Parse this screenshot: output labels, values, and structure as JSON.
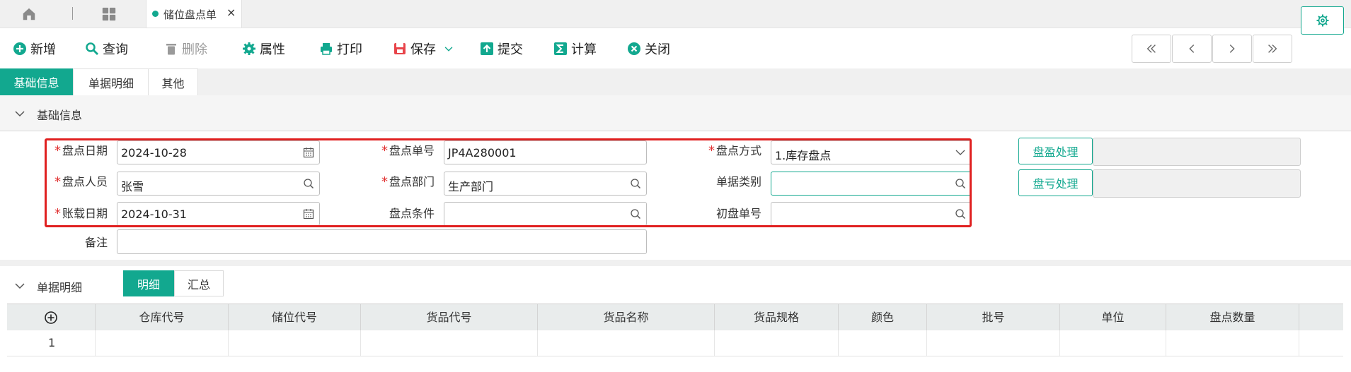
{
  "tabbar": {
    "doc_tab_label": "储位盘点单",
    "doc_tab_close": "×"
  },
  "toolbar": {
    "new": "新增",
    "query": "查询",
    "delete": "删除",
    "properties": "属性",
    "print": "打印",
    "save": "保存",
    "submit": "提交",
    "calculate": "计算",
    "close": "关闭"
  },
  "form_tabs": [
    "基础信息",
    "单据明细",
    "其他"
  ],
  "basic_section": {
    "title": "基础信息",
    "fields": {
      "count_date": {
        "label": "盘点日期",
        "value": "2024-10-28",
        "required": "*"
      },
      "count_no": {
        "label": "盘点单号",
        "value": "JP4A280001",
        "required": "*"
      },
      "count_method": {
        "label": "盘点方式",
        "value": "1.库存盘点",
        "required": "*"
      },
      "counter": {
        "label": "盘点人员",
        "value": "张雪",
        "required": "*"
      },
      "count_dept": {
        "label": "盘点部门",
        "value": "生产部门",
        "required": "*"
      },
      "doc_type": {
        "label": "单据类别",
        "value": ""
      },
      "book_date": {
        "label": "账载日期",
        "value": "2024-10-31",
        "required": "*"
      },
      "count_condition": {
        "label": "盘点条件",
        "value": ""
      },
      "initial_no": {
        "label": "初盘单号",
        "value": ""
      },
      "remark": {
        "label": "备注",
        "value": ""
      }
    },
    "surplus_button": "盘盈处理",
    "deficit_button": "盘亏处理"
  },
  "detail_section": {
    "title": "单据明细",
    "subtabs": [
      "明细",
      "汇总"
    ],
    "columns": [
      "仓库代号",
      "储位代号",
      "货品代号",
      "货品名称",
      "货品规格",
      "颜色",
      "批号",
      "单位",
      "盘点数量"
    ],
    "rows": [
      [
        "1",
        "",
        "",
        "",
        "",
        "",
        "",
        "",
        "",
        ""
      ]
    ]
  },
  "colors": {
    "accent": "#12a88f",
    "required": "#e03030",
    "highlight_box": "#e02020"
  }
}
